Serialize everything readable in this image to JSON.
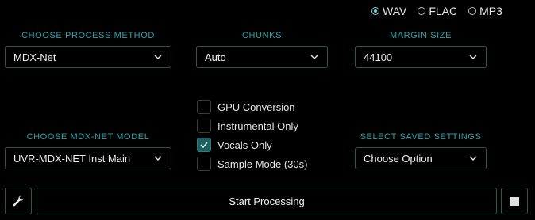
{
  "format_options": [
    {
      "label": "WAV",
      "selected": true
    },
    {
      "label": "FLAC",
      "selected": false
    },
    {
      "label": "MP3",
      "selected": false
    }
  ],
  "process_method": {
    "label": "CHOOSE PROCESS METHOD",
    "value": "MDX-Net"
  },
  "chunks": {
    "label": "CHUNKS",
    "value": "Auto"
  },
  "margin_size": {
    "label": "MARGIN SIZE",
    "value": "44100"
  },
  "mdx_model": {
    "label": "CHOOSE MDX-NET MODEL",
    "value": "UVR-MDX-NET Inst Main"
  },
  "saved_settings": {
    "label": "SELECT SAVED SETTINGS",
    "value": "Choose Option"
  },
  "options": [
    {
      "label": "GPU Conversion",
      "checked": false
    },
    {
      "label": "Instrumental Only",
      "checked": false
    },
    {
      "label": "Vocals Only",
      "checked": true
    },
    {
      "label": "Sample Mode (30s)",
      "checked": false
    }
  ],
  "start_button": {
    "label": "Start Processing"
  },
  "icons": {
    "settings": "wrench-icon",
    "stop": "stop-icon",
    "dropdown": "chevron-down-icon"
  },
  "colors": {
    "accent": "#2fa3a8",
    "border": "#2a5a4a",
    "checked": "#1f5f5d"
  }
}
